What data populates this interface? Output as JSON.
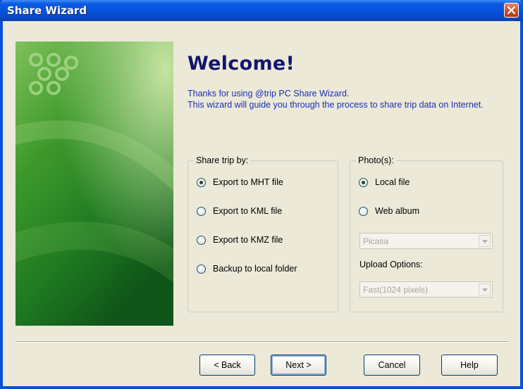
{
  "window": {
    "title": "Share Wizard",
    "close_icon": "close-icon"
  },
  "header": {
    "welcome": "Welcome!",
    "intro_line1": "Thanks for using @trip PC Share Wizard.",
    "intro_line2": "This wizard will guide you through the process to share trip data on Internet."
  },
  "share_group": {
    "legend": "Share trip by:",
    "options": [
      {
        "label": "Export to MHT file",
        "checked": true
      },
      {
        "label": "Export to KML file",
        "checked": false
      },
      {
        "label": "Export to KMZ file",
        "checked": false
      },
      {
        "label": "Backup to local folder",
        "checked": false
      }
    ]
  },
  "photo_group": {
    "legend": "Photo(s):",
    "options": [
      {
        "label": "Local file",
        "checked": true
      },
      {
        "label": "Web album",
        "checked": false
      }
    ],
    "album_select": "Picasa",
    "upload_label": "Upload Options:",
    "upload_select": "Fast(1024 pixels)"
  },
  "buttons": {
    "back": "< Back",
    "next": "Next >",
    "cancel": "Cancel",
    "help": "Help"
  },
  "colors": {
    "titlebar": "#0650dd",
    "welcome_text": "#13166a",
    "intro_text": "#1a2fb8",
    "banner_green": "#1f7a21"
  }
}
